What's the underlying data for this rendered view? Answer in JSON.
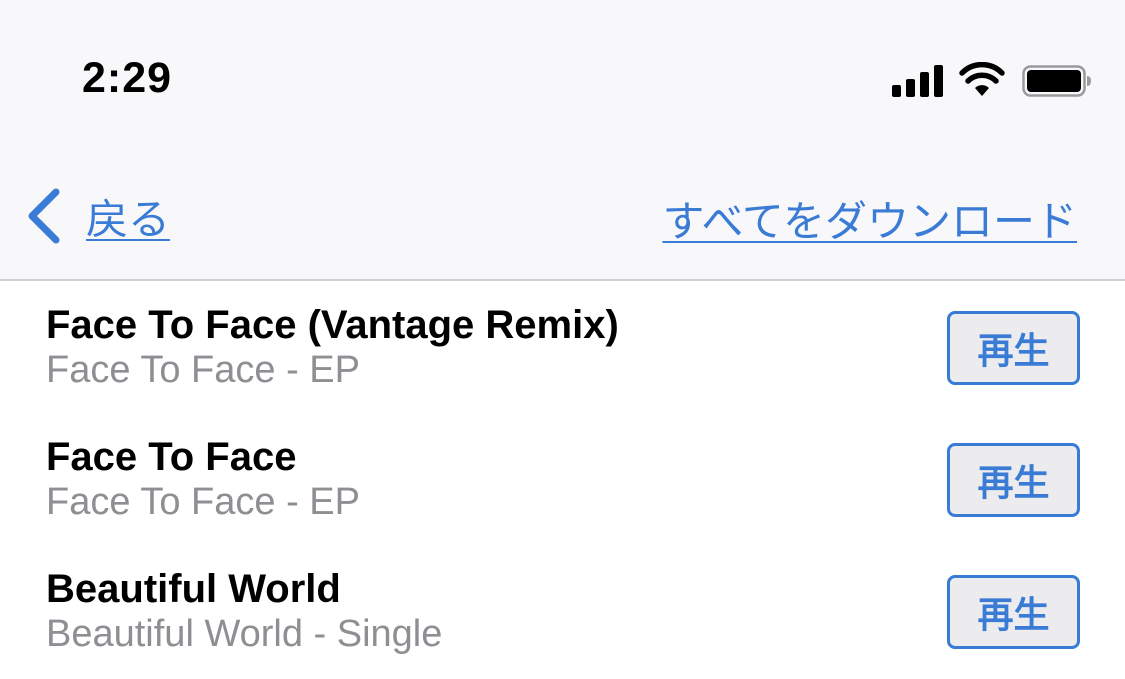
{
  "status_bar": {
    "time": "2:29",
    "icons": [
      "cellular-signal-icon",
      "wifi-icon",
      "battery-icon"
    ]
  },
  "nav": {
    "back_label": "戻る",
    "download_all_label": "すべてをダウンロード"
  },
  "tracks": [
    {
      "title": "Face To Face (Vantage Remix)",
      "subtitle": "Face To Face - EP",
      "play_label": "再生"
    },
    {
      "title": "Face To Face",
      "subtitle": "Face To Face - EP",
      "play_label": "再生"
    },
    {
      "title": "Beautiful World",
      "subtitle": "Beautiful World - Single",
      "play_label": "再生"
    }
  ],
  "colors": {
    "accent": "#3a7bd5",
    "secondary_text": "#8e8e93",
    "bar_background": "#f8f8fa"
  }
}
